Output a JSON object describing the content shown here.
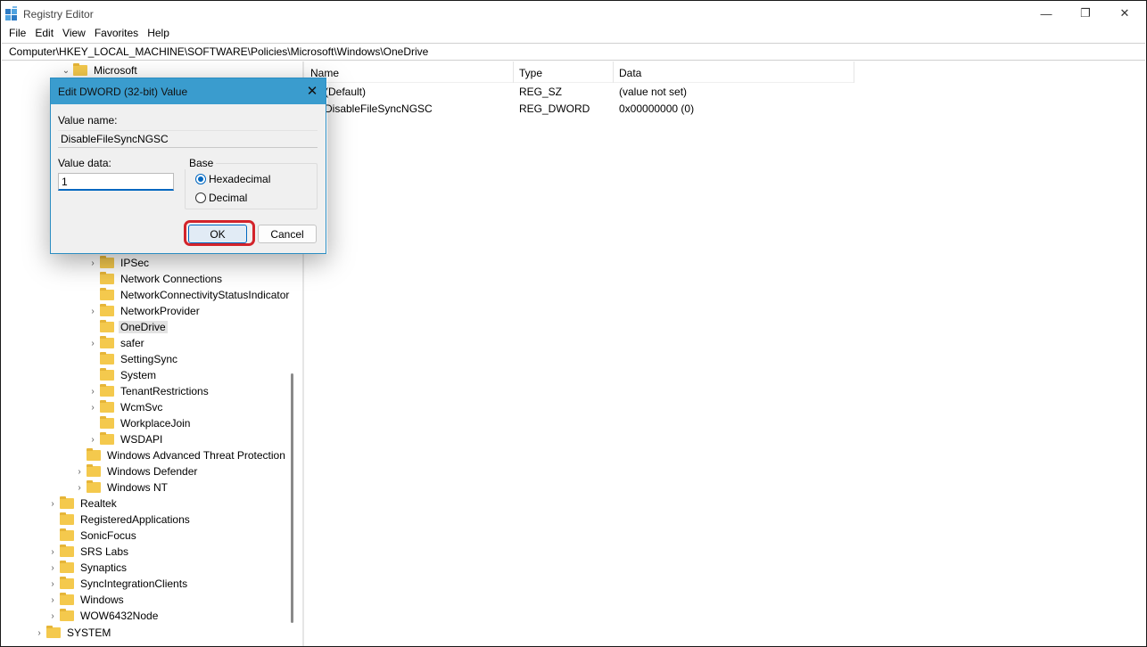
{
  "window": {
    "title": "Registry Editor",
    "minimize_glyph": "—",
    "restore_glyph": "❐",
    "close_glyph": "✕",
    "app_icon": "registry-editor-icon"
  },
  "menu": [
    "File",
    "Edit",
    "View",
    "Favorites",
    "Help"
  ],
  "address": "Computer\\HKEY_LOCAL_MACHINE\\SOFTWARE\\Policies\\Microsoft\\Windows\\OneDrive",
  "tree": {
    "top": {
      "label": "Microsoft",
      "chevron": "⌄"
    },
    "items": [
      {
        "label": "IPSec",
        "chevron": "›"
      },
      {
        "label": "Network Connections",
        "chevron": ""
      },
      {
        "label": "NetworkConnectivityStatusIndicator",
        "chevron": ""
      },
      {
        "label": "NetworkProvider",
        "chevron": "›"
      },
      {
        "label": "OneDrive",
        "chevron": "",
        "selected": true
      },
      {
        "label": "safer",
        "chevron": "›"
      },
      {
        "label": "SettingSync",
        "chevron": ""
      },
      {
        "label": "System",
        "chevron": ""
      },
      {
        "label": "TenantRestrictions",
        "chevron": "›"
      },
      {
        "label": "WcmSvc",
        "chevron": "›"
      },
      {
        "label": "WorkplaceJoin",
        "chevron": ""
      },
      {
        "label": "WSDAPI",
        "chevron": "›"
      }
    ],
    "level2": [
      {
        "label": "Windows Advanced Threat Protection",
        "chevron": ""
      },
      {
        "label": "Windows Defender",
        "chevron": "›"
      },
      {
        "label": "Windows NT",
        "chevron": "›"
      }
    ],
    "level1": [
      {
        "label": "Realtek",
        "chevron": "›"
      },
      {
        "label": "RegisteredApplications",
        "chevron": ""
      },
      {
        "label": "SonicFocus",
        "chevron": ""
      },
      {
        "label": "SRS Labs",
        "chevron": "›"
      },
      {
        "label": "Synaptics",
        "chevron": "›"
      },
      {
        "label": "SyncIntegrationClients",
        "chevron": "›"
      },
      {
        "label": "Windows",
        "chevron": "›"
      },
      {
        "label": "WOW6432Node",
        "chevron": "›"
      }
    ],
    "root": {
      "label": "SYSTEM",
      "chevron": "›"
    }
  },
  "list": {
    "columns": [
      "Name",
      "Type",
      "Data"
    ],
    "rows": [
      {
        "name": "(Default)",
        "type": "REG_SZ",
        "data": "(value not set)"
      },
      {
        "name": "DisableFileSyncNGSC",
        "type": "REG_DWORD",
        "data": "0x00000000 (0)"
      }
    ]
  },
  "dialog": {
    "title": "Edit DWORD (32-bit) Value",
    "close_glyph": "✕",
    "value_name_label": "Value name:",
    "value_name": "DisableFileSyncNGSC",
    "value_data_label": "Value data:",
    "value_data": "1",
    "base_label": "Base",
    "base_options": [
      {
        "label": "Hexadecimal",
        "checked": true
      },
      {
        "label": "Decimal",
        "checked": false
      }
    ],
    "ok_label": "OK",
    "cancel_label": "Cancel",
    "highlight_color": "#d3242b"
  }
}
